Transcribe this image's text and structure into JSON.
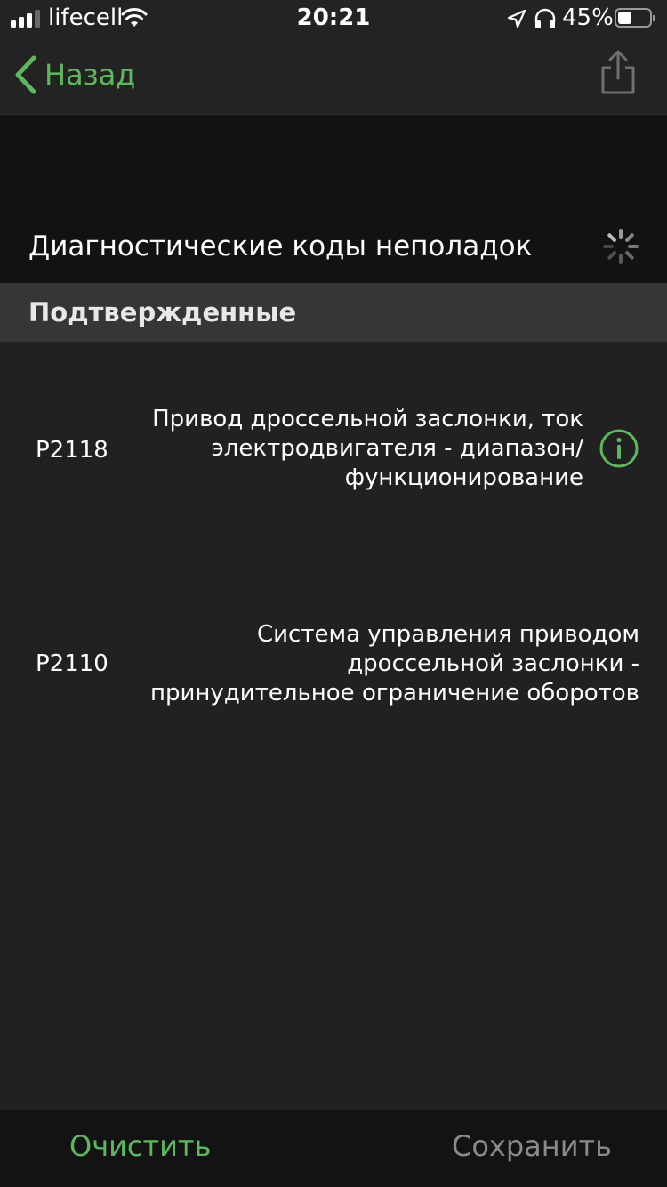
{
  "status_bar": {
    "carrier": "lifecell",
    "time": "20:21",
    "battery_percent": "45%",
    "battery_level": 0.45,
    "signal_bars": 3,
    "icons": [
      "signal-icon",
      "wifi-icon",
      "location-icon",
      "headphones-icon",
      "battery-icon"
    ]
  },
  "nav": {
    "back_label": "Назад",
    "back_icon": "chevron-left-icon",
    "share_icon": "share-icon"
  },
  "header": {
    "title": "Диагностические коды неполадок",
    "activity_icon": "activity-spinner-icon"
  },
  "section": {
    "title": "Подтвержденные"
  },
  "codes": [
    {
      "code": "P2118",
      "description_lines": [
        "Привод дроссельной заслонки, ток",
        "электродвигателя - диапазон/",
        "функционирование"
      ],
      "has_info": true,
      "info_icon": "info-icon"
    },
    {
      "code": "P2110",
      "description_lines": [
        "Система управления приводом",
        "дроссельной заслонки -",
        "принудительное ограничение оборотов"
      ],
      "has_info": false
    }
  ],
  "toolbar": {
    "clear_label": "Очистить",
    "save_label": "Сохранить"
  },
  "colors": {
    "accent": "#5cb85c",
    "background": "#212121",
    "header_background": "#121212",
    "section_background": "#363636",
    "toolbar_background": "#131313",
    "disabled_text": "#8a8a8a"
  }
}
